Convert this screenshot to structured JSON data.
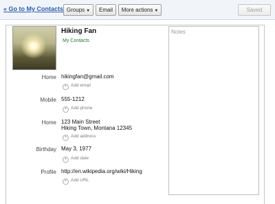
{
  "toolbar": {
    "back_label": "« Go to My Contacts",
    "groups_label": "Groups",
    "email_label": "Email",
    "more_actions_label": "More actions",
    "saved_label": "Saved"
  },
  "contact": {
    "name": "Hiking Fan",
    "group": "My Contacts"
  },
  "fields": {
    "email": {
      "label": "Home",
      "value": "hikingfan@gmail.com",
      "add": "Add email"
    },
    "phone": {
      "label": "Mobile",
      "value": "555-1212",
      "add": "Add phone"
    },
    "address": {
      "label": "Home",
      "line1": "123 Main Street",
      "line2": "Hiking Town, Montana 12345",
      "add": "Add address"
    },
    "birthday": {
      "label": "Birthday",
      "value": "May 3, 1977",
      "add": "Add date"
    },
    "profile": {
      "label": "Profile",
      "value": "http://en.wikipedia.org/wiki/Hiking",
      "add": "Add URL"
    }
  },
  "notes": {
    "placeholder": "Notes"
  },
  "icons": {
    "groups_dropdown": "chevron-down-icon",
    "more_actions_dropdown": "chevron-down-icon",
    "add": "plus-circle-icon"
  },
  "colors": {
    "link": "#2a5db0",
    "group_label": "#1a7f2a",
    "toolbar_bg": "#f1f5fa"
  }
}
